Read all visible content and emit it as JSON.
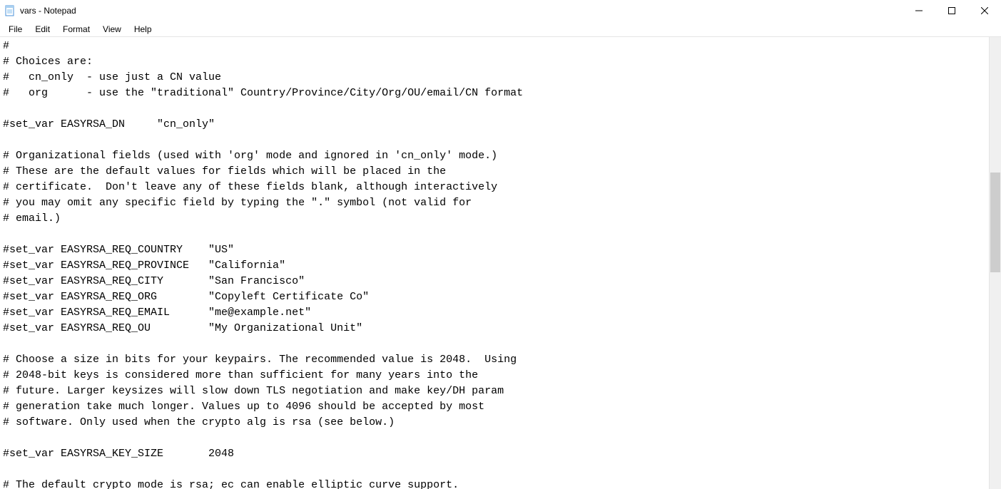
{
  "window": {
    "title": "vars - Notepad"
  },
  "menu": {
    "file": "File",
    "edit": "Edit",
    "format": "Format",
    "view": "View",
    "help": "Help"
  },
  "editor": {
    "content": "#\n# Choices are:\n#   cn_only  - use just a CN value\n#   org      - use the \"traditional\" Country/Province/City/Org/OU/email/CN format\n\n#set_var EASYRSA_DN     \"cn_only\"\n\n# Organizational fields (used with 'org' mode and ignored in 'cn_only' mode.)\n# These are the default values for fields which will be placed in the\n# certificate.  Don't leave any of these fields blank, although interactively\n# you may omit any specific field by typing the \".\" symbol (not valid for\n# email.)\n\n#set_var EASYRSA_REQ_COUNTRY    \"US\"\n#set_var EASYRSA_REQ_PROVINCE   \"California\"\n#set_var EASYRSA_REQ_CITY       \"San Francisco\"\n#set_var EASYRSA_REQ_ORG        \"Copyleft Certificate Co\"\n#set_var EASYRSA_REQ_EMAIL      \"me@example.net\"\n#set_var EASYRSA_REQ_OU         \"My Organizational Unit\"\n\n# Choose a size in bits for your keypairs. The recommended value is 2048.  Using\n# 2048-bit keys is considered more than sufficient for many years into the\n# future. Larger keysizes will slow down TLS negotiation and make key/DH param\n# generation take much longer. Values up to 4096 should be accepted by most\n# software. Only used when the crypto alg is rsa (see below.)\n\n#set_var EASYRSA_KEY_SIZE       2048\n\n# The default crypto mode is rsa; ec can enable elliptic curve support."
  }
}
